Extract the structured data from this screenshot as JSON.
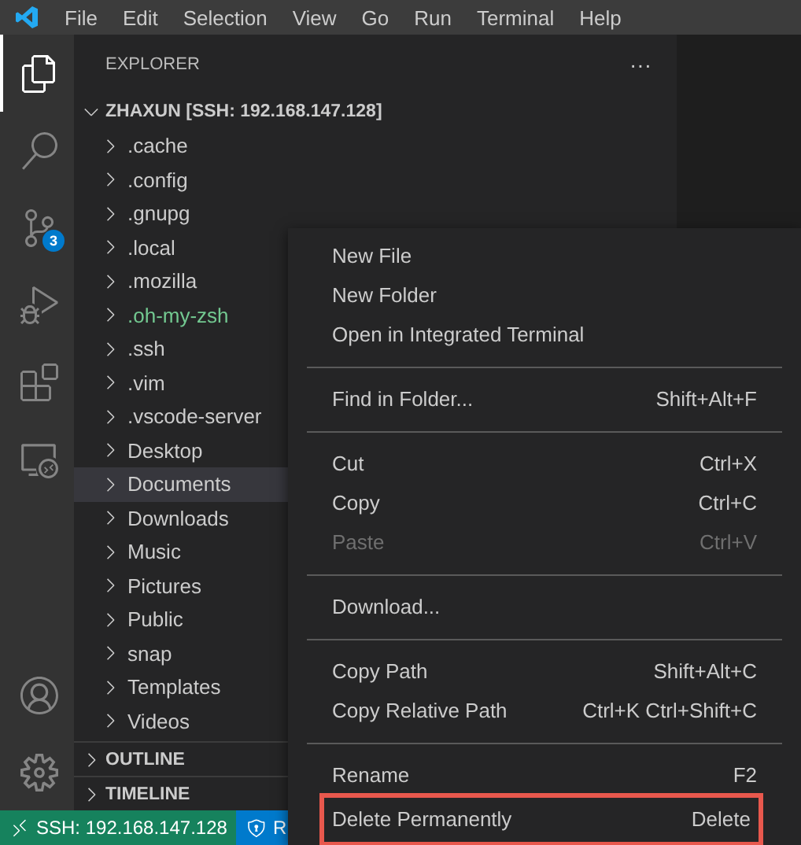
{
  "menu_bar": [
    "File",
    "Edit",
    "Selection",
    "View",
    "Go",
    "Run",
    "Terminal",
    "Help"
  ],
  "activity_bar": {
    "items": [
      {
        "selected": true
      },
      {
        "selected": false
      },
      {
        "selected": false,
        "badge": "3"
      },
      {
        "selected": false
      },
      {
        "selected": false
      },
      {
        "selected": false
      }
    ]
  },
  "explorer": {
    "title": "EXPLORER",
    "more": "···",
    "root": {
      "label": "ZHAXUN [SSH: 192.168.147.128]",
      "expanded": true,
      "children": [
        {
          "label": ".cache",
          "selected": false,
          "color": "#cccccc"
        },
        {
          "label": ".config",
          "selected": false,
          "color": "#cccccc"
        },
        {
          "label": ".gnupg",
          "selected": false,
          "color": "#cccccc"
        },
        {
          "label": ".local",
          "selected": false,
          "color": "#cccccc"
        },
        {
          "label": ".mozilla",
          "selected": false,
          "color": "#cccccc"
        },
        {
          "label": ".oh-my-zsh",
          "selected": false,
          "color": "#73c991"
        },
        {
          "label": ".ssh",
          "selected": false,
          "color": "#cccccc"
        },
        {
          "label": ".vim",
          "selected": false,
          "color": "#cccccc"
        },
        {
          "label": ".vscode-server",
          "selected": false,
          "color": "#cccccc"
        },
        {
          "label": "Desktop",
          "selected": false,
          "color": "#cccccc"
        },
        {
          "label": "Documents",
          "selected": true,
          "color": "#cccccc"
        },
        {
          "label": "Downloads",
          "selected": false,
          "color": "#cccccc"
        },
        {
          "label": "Music",
          "selected": false,
          "color": "#cccccc"
        },
        {
          "label": "Pictures",
          "selected": false,
          "color": "#cccccc"
        },
        {
          "label": "Public",
          "selected": false,
          "color": "#cccccc"
        },
        {
          "label": "snap",
          "selected": false,
          "color": "#cccccc"
        },
        {
          "label": "Templates",
          "selected": false,
          "color": "#cccccc"
        },
        {
          "label": "Videos",
          "selected": false,
          "color": "#cccccc"
        }
      ]
    },
    "sections": [
      {
        "label": "OUTLINE",
        "expanded": false
      },
      {
        "label": "TIMELINE",
        "expanded": false
      }
    ]
  },
  "status_bar": [
    {
      "kind": "remote",
      "label": "SSH: 192.168.147.128"
    },
    {
      "kind": "shield",
      "label": "R"
    }
  ],
  "context_menu": [
    {
      "kind": "item",
      "label": "New File",
      "disabled": false
    },
    {
      "kind": "item",
      "label": "New Folder",
      "disabled": false
    },
    {
      "kind": "item",
      "label": "Open in Integrated Terminal",
      "disabled": false
    },
    {
      "kind": "separator"
    },
    {
      "kind": "item",
      "label": "Find in Folder...",
      "shortcut": "Shift+Alt+F",
      "disabled": false
    },
    {
      "kind": "separator"
    },
    {
      "kind": "item",
      "label": "Cut",
      "shortcut": "Ctrl+X",
      "disabled": false
    },
    {
      "kind": "item",
      "label": "Copy",
      "shortcut": "Ctrl+C",
      "disabled": false
    },
    {
      "kind": "item",
      "label": "Paste",
      "shortcut": "Ctrl+V",
      "disabled": true
    },
    {
      "kind": "separator"
    },
    {
      "kind": "item",
      "label": "Download...",
      "disabled": false
    },
    {
      "kind": "separator"
    },
    {
      "kind": "item",
      "label": "Copy Path",
      "shortcut": "Shift+Alt+C",
      "disabled": false
    },
    {
      "kind": "item",
      "label": "Copy Relative Path",
      "shortcut": "Ctrl+K Ctrl+Shift+C",
      "disabled": false
    },
    {
      "kind": "separator"
    },
    {
      "kind": "item",
      "label": "Rename",
      "shortcut": "F2",
      "disabled": false
    },
    {
      "kind": "item",
      "label": "Delete Permanently",
      "shortcut": "Delete",
      "disabled": false,
      "highlighted": true
    }
  ]
}
